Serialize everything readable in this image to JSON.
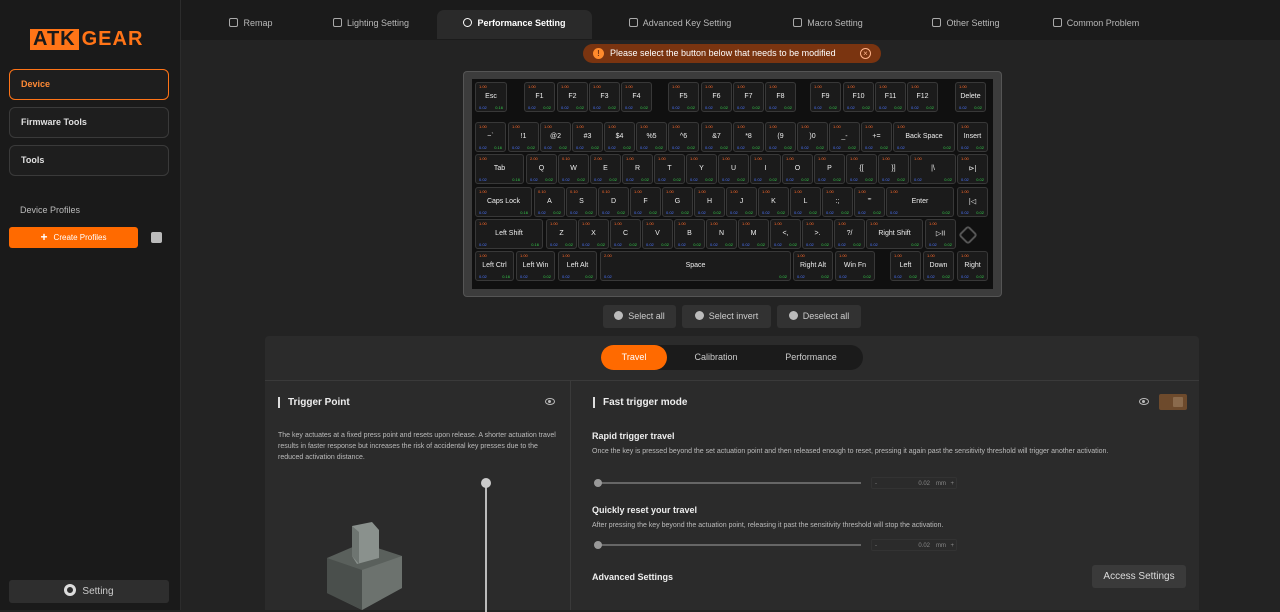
{
  "brand": {
    "logo_box": "ATK",
    "logo_text": "GEAR",
    "accent": "#ff6a00"
  },
  "sidebar": {
    "items": [
      {
        "label": "Device",
        "active": true
      },
      {
        "label": "Firmware Tools",
        "active": false
      },
      {
        "label": "Tools",
        "active": false
      }
    ],
    "profiles_label": "Device Profiles",
    "create_label": "Create Profiles",
    "setting_label": "Setting"
  },
  "tabs": [
    {
      "label": "Remap",
      "icon": "remap-icon"
    },
    {
      "label": "Lighting Setting",
      "icon": "sun-icon"
    },
    {
      "label": "Performance Setting",
      "icon": "gauge-icon",
      "active": true
    },
    {
      "label": "Advanced Key Setting",
      "icon": "wand-icon"
    },
    {
      "label": "Macro Setting",
      "icon": "macro-icon"
    },
    {
      "label": "Other Setting",
      "icon": "gear-icon"
    },
    {
      "label": "Common Problem",
      "icon": "question-icon"
    }
  ],
  "alert": {
    "icon": "!",
    "text": "Please select the button below that needs to be modified",
    "close": "×"
  },
  "keyboard": {
    "rows": [
      [
        {
          "l": "Esc",
          "t": "1.00",
          "b": "0.02",
          "g": "0.16"
        },
        {
          "l": "F1",
          "t": "1.00",
          "b": "0.02",
          "g": "0.02"
        },
        {
          "l": "F2",
          "t": "1.00",
          "b": "0.02",
          "g": "0.02"
        },
        {
          "l": "F3",
          "t": "1.00",
          "b": "0.02",
          "g": "0.02"
        },
        {
          "l": "F4",
          "t": "1.00",
          "b": "0.02",
          "g": "0.02"
        },
        {
          "l": "F5",
          "t": "1.00",
          "b": "0.02",
          "g": "0.02"
        },
        {
          "l": "F6",
          "t": "1.00",
          "b": "0.02",
          "g": "0.02"
        },
        {
          "l": "F7",
          "t": "1.00",
          "b": "0.02",
          "g": "0.02"
        },
        {
          "l": "F8",
          "t": "1.00",
          "b": "0.02",
          "g": "0.02"
        },
        {
          "l": "F9",
          "t": "1.00",
          "b": "0.02",
          "g": "0.02"
        },
        {
          "l": "F10",
          "t": "1.00",
          "b": "0.02",
          "g": "0.02"
        },
        {
          "l": "F11",
          "t": "1.00",
          "b": "0.02",
          "g": "0.02"
        },
        {
          "l": "F12",
          "t": "1.00",
          "b": "0.02",
          "g": "0.02"
        },
        {
          "l": "Delete",
          "t": "1.00",
          "b": "0.02",
          "g": "0.02"
        }
      ],
      [
        {
          "l": "~`",
          "t": "1.00",
          "b": "0.02",
          "g": "0.16"
        },
        {
          "l": "!1",
          "t": "1.00",
          "b": "0.02",
          "g": "0.02"
        },
        {
          "l": "@2",
          "t": "1.00",
          "b": "0.02",
          "g": "0.02"
        },
        {
          "l": "#3",
          "t": "1.00",
          "b": "0.02",
          "g": "0.02"
        },
        {
          "l": "$4",
          "t": "1.00",
          "b": "0.02",
          "g": "0.02"
        },
        {
          "l": "%5",
          "t": "1.00",
          "b": "0.02",
          "g": "0.02"
        },
        {
          "l": "^6",
          "t": "1.00",
          "b": "0.02",
          "g": "0.02"
        },
        {
          "l": "&7",
          "t": "1.00",
          "b": "0.02",
          "g": "0.02"
        },
        {
          "l": "*8",
          "t": "1.00",
          "b": "0.02",
          "g": "0.02"
        },
        {
          "l": "(9",
          "t": "1.00",
          "b": "0.02",
          "g": "0.02"
        },
        {
          "l": ")0",
          "t": "1.00",
          "b": "0.02",
          "g": "0.02"
        },
        {
          "l": "_-",
          "t": "1.00",
          "b": "0.02",
          "g": "0.02"
        },
        {
          "l": "+=",
          "t": "1.00",
          "b": "0.02",
          "g": "0.02"
        },
        {
          "l": "Back Space",
          "t": "1.00",
          "b": "0.02",
          "g": "0.02"
        },
        {
          "l": "Insert",
          "t": "1.00",
          "b": "0.02",
          "g": "0.02"
        }
      ],
      [
        {
          "l": "Tab",
          "t": "1.00",
          "b": "0.02",
          "g": "0.16"
        },
        {
          "l": "Q",
          "t": "2.00",
          "b": "0.02",
          "g": "0.02"
        },
        {
          "l": "W",
          "t": "0.10",
          "b": "0.02",
          "g": "0.02"
        },
        {
          "l": "E",
          "t": "2.00",
          "b": "0.02",
          "g": "0.02"
        },
        {
          "l": "R",
          "t": "1.00",
          "b": "0.02",
          "g": "0.02"
        },
        {
          "l": "T",
          "t": "1.00",
          "b": "0.02",
          "g": "0.02"
        },
        {
          "l": "Y",
          "t": "1.00",
          "b": "0.02",
          "g": "0.02"
        },
        {
          "l": "U",
          "t": "1.00",
          "b": "0.02",
          "g": "0.02"
        },
        {
          "l": "I",
          "t": "1.00",
          "b": "0.02",
          "g": "0.02"
        },
        {
          "l": "O",
          "t": "1.00",
          "b": "0.02",
          "g": "0.02"
        },
        {
          "l": "P",
          "t": "1.00",
          "b": "0.02",
          "g": "0.02"
        },
        {
          "l": "{[",
          "t": "1.00",
          "b": "0.02",
          "g": "0.02"
        },
        {
          "l": "}]",
          "t": "1.00",
          "b": "0.02",
          "g": "0.02"
        },
        {
          "l": "|\\",
          "t": "1.00",
          "b": "0.02",
          "g": "0.02"
        },
        {
          "l": "⊳|",
          "t": "1.00",
          "b": "0.02",
          "g": "0.02"
        }
      ],
      [
        {
          "l": "Caps Lock",
          "t": "1.00",
          "b": "0.02",
          "g": "0.16"
        },
        {
          "l": "A",
          "t": "0.10",
          "b": "0.02",
          "g": "0.02"
        },
        {
          "l": "S",
          "t": "0.10",
          "b": "0.02",
          "g": "0.02"
        },
        {
          "l": "D",
          "t": "0.10",
          "b": "0.02",
          "g": "0.02"
        },
        {
          "l": "F",
          "t": "1.00",
          "b": "0.02",
          "g": "0.02"
        },
        {
          "l": "G",
          "t": "1.00",
          "b": "0.02",
          "g": "0.02"
        },
        {
          "l": "H",
          "t": "1.00",
          "b": "0.02",
          "g": "0.02"
        },
        {
          "l": "J",
          "t": "1.00",
          "b": "0.02",
          "g": "0.02"
        },
        {
          "l": "K",
          "t": "1.00",
          "b": "0.02",
          "g": "0.02"
        },
        {
          "l": "L",
          "t": "1.00",
          "b": "0.02",
          "g": "0.02"
        },
        {
          "l": ":;",
          "t": "1.00",
          "b": "0.02",
          "g": "0.02"
        },
        {
          "l": "\"'",
          "t": "1.00",
          "b": "0.02",
          "g": "0.02"
        },
        {
          "l": "Enter",
          "t": "1.00",
          "b": "0.02",
          "g": "0.02"
        },
        {
          "l": "|◁",
          "t": "1.00",
          "b": "0.02",
          "g": "0.02"
        }
      ],
      [
        {
          "l": "Left Shift",
          "t": "1.00",
          "b": "0.02",
          "g": "0.16"
        },
        {
          "l": "Z",
          "t": "1.00",
          "b": "0.02",
          "g": "0.02"
        },
        {
          "l": "X",
          "t": "1.00",
          "b": "0.02",
          "g": "0.02"
        },
        {
          "l": "C",
          "t": "1.00",
          "b": "0.02",
          "g": "0.02"
        },
        {
          "l": "V",
          "t": "1.00",
          "b": "0.02",
          "g": "0.02"
        },
        {
          "l": "B",
          "t": "1.00",
          "b": "0.02",
          "g": "0.02"
        },
        {
          "l": "N",
          "t": "1.00",
          "b": "0.02",
          "g": "0.02"
        },
        {
          "l": "M",
          "t": "1.00",
          "b": "0.02",
          "g": "0.02"
        },
        {
          "l": "<,",
          "t": "1.00",
          "b": "0.02",
          "g": "0.02"
        },
        {
          "l": ">.",
          "t": "1.00",
          "b": "0.02",
          "g": "0.02"
        },
        {
          "l": "?/",
          "t": "1.00",
          "b": "0.02",
          "g": "0.02"
        },
        {
          "l": "Right Shift",
          "t": "1.00",
          "b": "0.02",
          "g": "0.02"
        },
        {
          "l": "▷II",
          "t": "1.00",
          "b": "0.02",
          "g": "0.02"
        }
      ],
      [
        {
          "l": "Left Ctrl",
          "t": "1.00",
          "b": "0.02",
          "g": "0.16"
        },
        {
          "l": "Left Win",
          "t": "1.00",
          "b": "0.02",
          "g": "0.02"
        },
        {
          "l": "Left Alt",
          "t": "1.00",
          "b": "0.02",
          "g": "0.02"
        },
        {
          "l": "Space",
          "t": "2.00",
          "b": "0.02",
          "g": "0.02"
        },
        {
          "l": "Right Alt",
          "t": "1.00",
          "b": "0.02",
          "g": "0.02"
        },
        {
          "l": "Win Fn",
          "t": "1.00",
          "b": "0.02",
          "g": "0.02"
        },
        {
          "l": "Left",
          "t": "1.00",
          "b": "0.02",
          "g": "0.02"
        },
        {
          "l": "Down",
          "t": "1.00",
          "b": "0.02",
          "g": "0.02"
        },
        {
          "l": "Right",
          "t": "1.00",
          "b": "0.02",
          "g": "0.02"
        }
      ]
    ]
  },
  "selection": {
    "select_all": "Select all",
    "select_invert": "Select invert",
    "deselect_all": "Deselect all"
  },
  "panel": {
    "tabs": [
      {
        "label": "Travel",
        "active": true
      },
      {
        "label": "Calibration"
      },
      {
        "label": "Performance"
      }
    ],
    "trigger_point": {
      "title": "Trigger Point",
      "desc": "The key actuates at a fixed press point and resets upon release. A shorter actuation travel results in faster response but increases the risk of accidental key presses due to the reduced activation distance."
    },
    "fast_trigger": {
      "title": "Fast trigger mode",
      "enabled": true,
      "rapid_title": "Rapid trigger travel",
      "rapid_desc": "Once the key is pressed beyond the set actuation point and then released enough to reset, pressing it again past the sensitivity threshold will trigger another activation.",
      "rapid_value": "0.02",
      "reset_title": "Quickly reset your travel",
      "reset_desc": "After pressing the key beyond the actuation point, releasing it past the sensitivity threshold will stop the activation.",
      "reset_value": "0.02",
      "unit": "mm",
      "minus": "-",
      "plus": "+",
      "advanced_label": "Advanced Settings",
      "access_label": "Access Settings"
    }
  }
}
